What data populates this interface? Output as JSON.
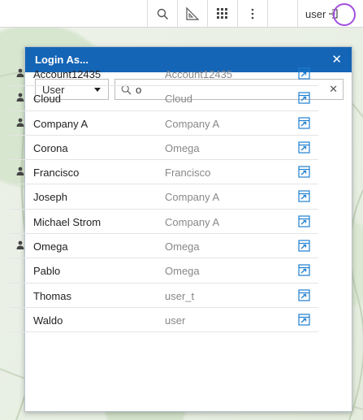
{
  "toolbar": {
    "user_label": "user",
    "icons": [
      "search-icon",
      "measure-icon",
      "grid-icon",
      "more-icon",
      "logout-icon"
    ]
  },
  "dialog": {
    "title": "Login As...",
    "type_select": {
      "value": "User"
    },
    "search": {
      "value": "o"
    },
    "rows": [
      {
        "name": "Account12435",
        "company": "Account12435",
        "has_user_icon": true
      },
      {
        "name": "Cloud",
        "company": "Cloud",
        "has_user_icon": true
      },
      {
        "name": "Company A",
        "company": "Company A",
        "has_user_icon": true
      },
      {
        "name": "Corona",
        "company": "Omega",
        "has_user_icon": false
      },
      {
        "name": "Francisco",
        "company": "Francisco",
        "has_user_icon": true
      },
      {
        "name": "Joseph",
        "company": "Company A",
        "has_user_icon": false
      },
      {
        "name": "Michael Strom",
        "company": "Company A",
        "has_user_icon": false
      },
      {
        "name": "Omega",
        "company": "Omega",
        "has_user_icon": true
      },
      {
        "name": "Pablo",
        "company": "Omega",
        "has_user_icon": false
      },
      {
        "name": "Thomas",
        "company": "user_t",
        "has_user_icon": false
      },
      {
        "name": "Waldo",
        "company": "user",
        "has_user_icon": false
      }
    ]
  },
  "colors": {
    "header": "#1565b6",
    "login_icon": "#1e7fd0",
    "highlight": "#a24fe0"
  }
}
